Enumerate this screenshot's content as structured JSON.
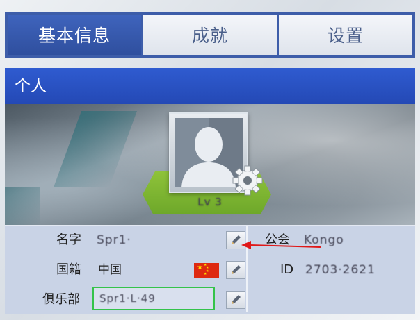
{
  "tabs": [
    {
      "label": "基本信息",
      "active": true
    },
    {
      "label": "成就",
      "active": false
    },
    {
      "label": "设置",
      "active": false
    }
  ],
  "panel": {
    "title": "个人",
    "player_name": "Lv 3"
  },
  "info": {
    "name_label": "名字",
    "name_value": "Spr1·",
    "guild_label": "公会",
    "guild_value": "Kongo",
    "nationality_label": "国籍",
    "nationality_value": "中国",
    "id_label": "ID",
    "id_value": "2703·2621",
    "club_label": "俱乐部",
    "club_value": "Spr1·L·49"
  },
  "colors": {
    "tab_active": "#2f4f9e",
    "header_blue": "#2449b5",
    "info_bg": "#c9d3e6",
    "club_border": "#34c34a",
    "arrow_red": "#e01818",
    "pedestal_green": "#7db431"
  },
  "icons": {
    "edit": "pencil-icon",
    "gear": "gear-icon",
    "flag": "china-flag-icon"
  }
}
